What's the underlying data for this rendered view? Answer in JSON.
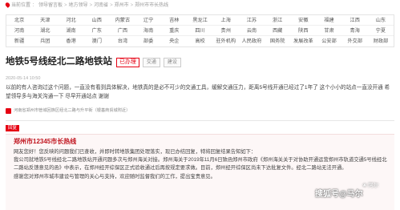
{
  "breadcrumb": [
    "当前位置",
    "领导留言板",
    "地方领导",
    "河南省",
    "郑州市",
    "郑州市市长热线"
  ],
  "regions": [
    [
      "北京",
      "天津",
      "河北",
      "山西",
      "内蒙古",
      "辽宁",
      "吉林",
      "黑龙江",
      "上海",
      "江苏",
      "浙江",
      "安徽",
      "福建",
      "江西",
      "山东"
    ],
    [
      "河南",
      "湖北",
      "湖南",
      "广东",
      "广西",
      "海南",
      "重庆",
      "四川",
      "贵州",
      "云南",
      "西藏",
      "陕西",
      "甘肃",
      "青海",
      "宁夏"
    ],
    [
      "新疆",
      "兵团",
      "香港",
      "澳门",
      "台湾",
      "部委",
      "央企",
      "高校",
      "驻外机构",
      "人民政府",
      "国务院",
      "发展改革",
      "公安部",
      "外交部",
      "财政部"
    ]
  ],
  "message": {
    "title": "地铁5号线经北二路地铁站",
    "status": "已办理",
    "tag1": "交通",
    "tag2": "建设",
    "meta": "2020-05-14 10:50",
    "question": "以前的有人咨询过这个问题，一直没有看到具体解决，地铁真的是必不可少的交通工具，缓解交通压力，距离5号线开通已经过了1年了 这个小小的站点一直没开通 希望领导多与海关沟通一下 尽早开通站点 谢谢",
    "location": "河南省郑州市管城回族区经北二路与升平街（银基商贸城附近）"
  },
  "reply": {
    "tag": "回复",
    "org": "郑州市12345市长热线",
    "paragraphs": [
      "网友您好！您反映的问题我们已查收，并即时转地铁集团处理落实，现已办结回复，特将回复结果告知如下：",
      "我公司就地铁5号线经北二路地铁站开通问题多次与郑州海关对接。郑州海关于2019年11月6日致函郑州市政府《郑州海关关于对协助开通运营郑州市轨道交通5号线经北二路站反馈意见的函》中表示，在郑州经开综保区正式验收通过后再按规定要求做。目前，郑州经开综保区尚未下达批复文件。经北二路站无法开通。",
      "感谢您对郑州市城市建设与管理的关心与支持，欢迎随时监督我们的工作，提出宝贵意见。"
    ]
  },
  "watermark": {
    "small": "❀ 阿尔",
    "main": "搜狐号@马尔"
  }
}
